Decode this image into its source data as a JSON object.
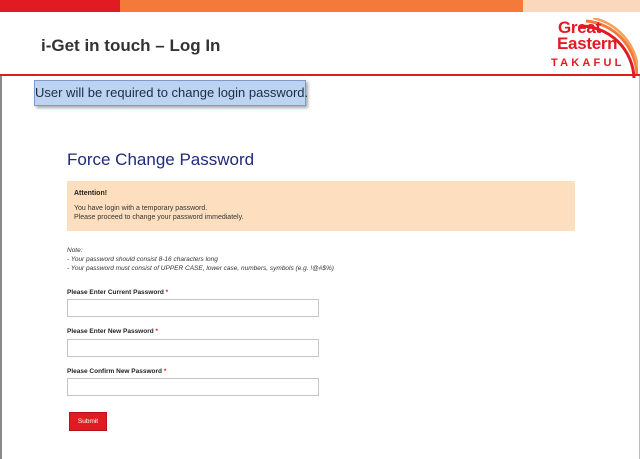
{
  "header": {
    "title": "i-Get in touch – Log In",
    "brand_colors": {
      "red": "#e11b22",
      "orange": "#f47a3a",
      "peach": "#fbd7bc"
    }
  },
  "logo": {
    "line1": "Great",
    "line2": "Eastern",
    "line3": "TAKAFUL"
  },
  "notice": {
    "text": "User will be required to change login password."
  },
  "form": {
    "title": "Force Change Password",
    "attention": {
      "heading": "Attention!",
      "line1": "You have login with a temporary password.",
      "line2": "Please proceed to change your password immediately."
    },
    "note": {
      "heading": "Note:",
      "line1": "- Your password should consist 8-16 characters long",
      "line2": "- Your password must consist of UPPER CASE, lower case, numbers, symbols (e.g. !@#$%)"
    },
    "fields": [
      {
        "label": "Please Enter Current Password",
        "required_mark": "*",
        "value": ""
      },
      {
        "label": "Please Enter New Password",
        "required_mark": "*",
        "value": ""
      },
      {
        "label": "Please Confirm New Password",
        "required_mark": "*",
        "value": ""
      }
    ],
    "submit_label": "Submit"
  }
}
